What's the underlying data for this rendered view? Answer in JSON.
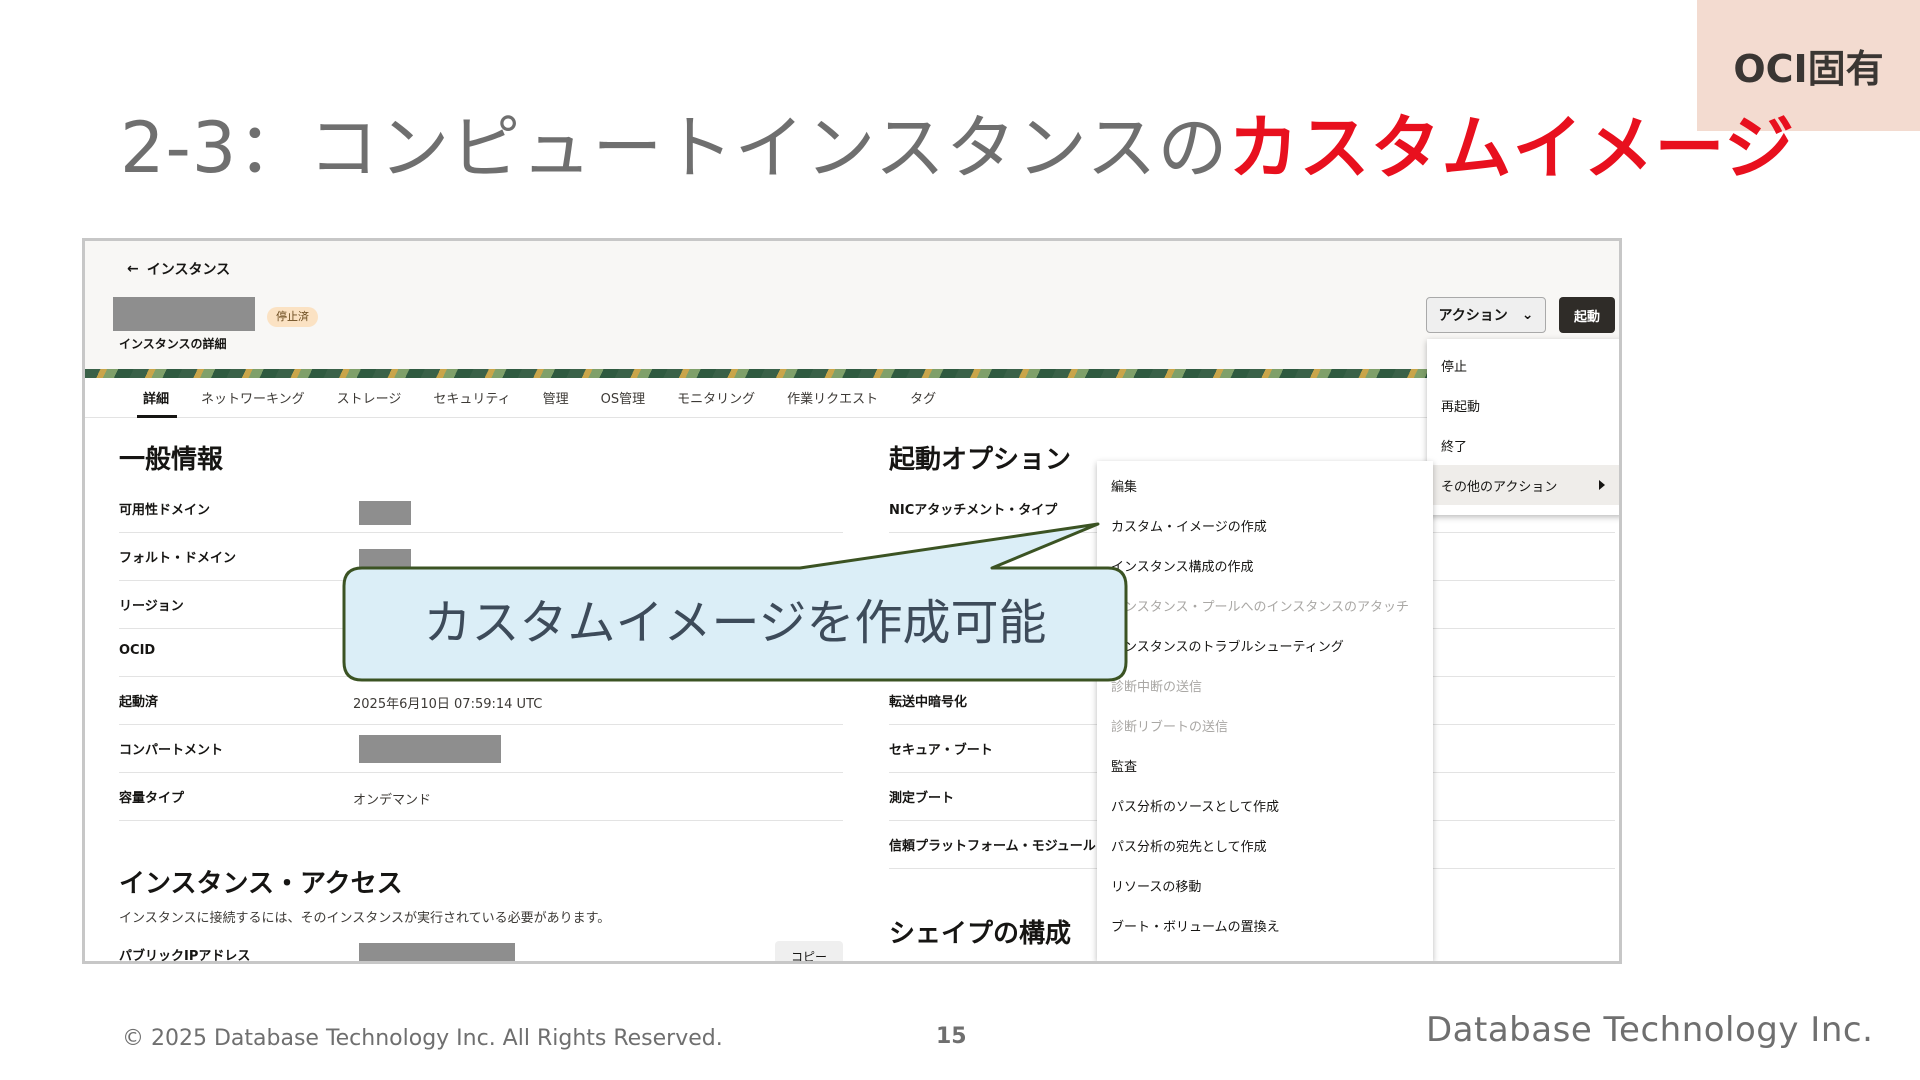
{
  "badge": "OCI固有",
  "slide_title": {
    "prefix": "2-3：コンピュートインスタンスの",
    "accent": "カスタムイメージ"
  },
  "console": {
    "back_link": "インスタンス",
    "status": "停止済",
    "subtitle": "インスタンスの詳細",
    "action_button": "アクション",
    "start_button": "起動",
    "tabs": [
      "詳細",
      "ネットワーキング",
      "ストレージ",
      "セキュリティ",
      "管理",
      "OS管理",
      "モニタリング",
      "作業リクエスト",
      "タグ"
    ],
    "general": {
      "title": "一般情報",
      "rows": [
        {
          "label": "可用性ドメイン",
          "value": ""
        },
        {
          "label": "フォルト・ドメイン",
          "value": ""
        },
        {
          "label": "リージョン",
          "value": ""
        },
        {
          "label": "OCID",
          "value": ""
        },
        {
          "label": "起動済",
          "value": "2025年6月10日 07:59:14 UTC"
        },
        {
          "label": "コンパートメント",
          "value": ""
        },
        {
          "label": "容量タイプ",
          "value": "オンデマンド"
        }
      ]
    },
    "launch": {
      "title": "起動オプション",
      "rows": [
        "NICアタッチメント・タイプ",
        "",
        "",
        "",
        "転送中暗号化",
        "セキュア・ブート",
        "測定ブート",
        "信頼プラットフォーム・モジュール"
      ]
    },
    "access": {
      "title": "インスタンス・アクセス",
      "description": "インスタンスに接続するには、そのインスタンスが実行されている必要があります。",
      "public_ip_label": "パブリックIPアドレス",
      "copy_button": "コピー"
    },
    "shape_title": "シェイプの構成",
    "action_menu": [
      "停止",
      "再起動",
      "終了",
      "その他のアクション"
    ],
    "more_actions": [
      {
        "label": "編集",
        "enabled": true
      },
      {
        "label": "カスタム・イメージの作成",
        "enabled": true
      },
      {
        "label": "インスタンス構成の作成",
        "enabled": true
      },
      {
        "label": "インスタンス・プールへのインスタンスのアタッチ",
        "enabled": false
      },
      {
        "label": "インスタンスのトラブルシューティング",
        "enabled": true
      },
      {
        "label": "診断中断の送信",
        "enabled": false
      },
      {
        "label": "診断リブートの送信",
        "enabled": false
      },
      {
        "label": "監査",
        "enabled": true
      },
      {
        "label": "パス分析のソースとして作成",
        "enabled": true
      },
      {
        "label": "パス分析の宛先として作成",
        "enabled": true
      },
      {
        "label": "リソースの移動",
        "enabled": true
      },
      {
        "label": "ブート・ボリュームの置換え",
        "enabled": true
      }
    ]
  },
  "callout": "カスタムイメージを作成可能",
  "footer": {
    "copyright": "© 2025 Database Technology Inc. All Rights Reserved.",
    "page": "15",
    "company": "Database Technology Inc."
  },
  "colors": {
    "accent": "#e8101e",
    "badge_bg": "#f3dbd0",
    "callout_fill": "#dbeef7",
    "callout_border": "#3b5323"
  }
}
